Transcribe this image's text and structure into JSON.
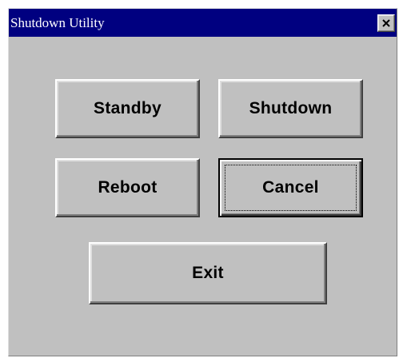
{
  "window": {
    "title": "Shutdown Utility",
    "close_icon": "close-icon"
  },
  "buttons": {
    "standby": "Standby",
    "shutdown": "Shutdown",
    "reboot": "Reboot",
    "cancel": "Cancel",
    "exit": "Exit"
  },
  "colors": {
    "titlebar": "#000080",
    "window_bg": "#c0c0c0",
    "title_text": "#ffffff"
  }
}
